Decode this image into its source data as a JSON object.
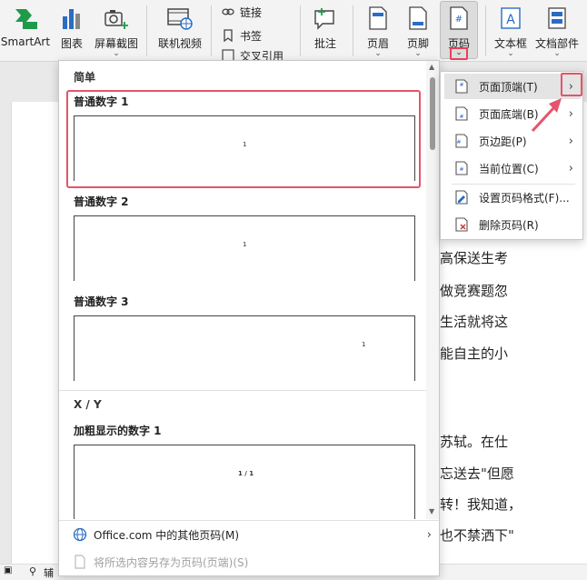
{
  "ribbon": {
    "smartart": "SmartArt",
    "chart": "图表",
    "screenshot": "屏幕截图",
    "online_video": "联机视频",
    "link": "链接",
    "bookmark": "书签",
    "cross_ref": "交叉引用",
    "comment": "批注",
    "header": "页眉",
    "footer": "页脚",
    "page_number": "页码",
    "textbox": "文本框",
    "doc_parts": "文档部件",
    "chev": "⌄"
  },
  "document": {
    "lines": [
      "高保送生考",
      "做竞赛题忽",
      "生活就将这",
      "能自主的小",
      "苏轼。在仕",
      "忘送去\"但愿",
      "转！我知道，",
      "也不禁洒下\""
    ]
  },
  "status": {
    "label": "辅"
  },
  "gallery": {
    "section_simple": "简单",
    "items": [
      {
        "title": "普通数字 1",
        "num": "1"
      },
      {
        "title": "普通数字 2",
        "num": "1"
      },
      {
        "title": "普通数字 3",
        "num": "1"
      }
    ],
    "section_xy": "X / Y",
    "bold_item": {
      "title": "加粗显示的数字 1",
      "num": "1 / 1"
    },
    "footer_more": "Office.com 中的其他页码(M)",
    "footer_save": "将所选内容另存为页码(页端)(S)"
  },
  "submenu": {
    "items": [
      {
        "label": "页面顶端(T)"
      },
      {
        "label": "页面底端(B)"
      },
      {
        "label": "页边距(P)"
      },
      {
        "label": "当前位置(C)"
      },
      {
        "label": "设置页码格式(F)..."
      },
      {
        "label": "删除页码(R)"
      }
    ]
  },
  "colors": {
    "accent_red": "#e5546a",
    "blue_icon": "#2b6cc4",
    "green_icon": "#1f9a4a"
  }
}
